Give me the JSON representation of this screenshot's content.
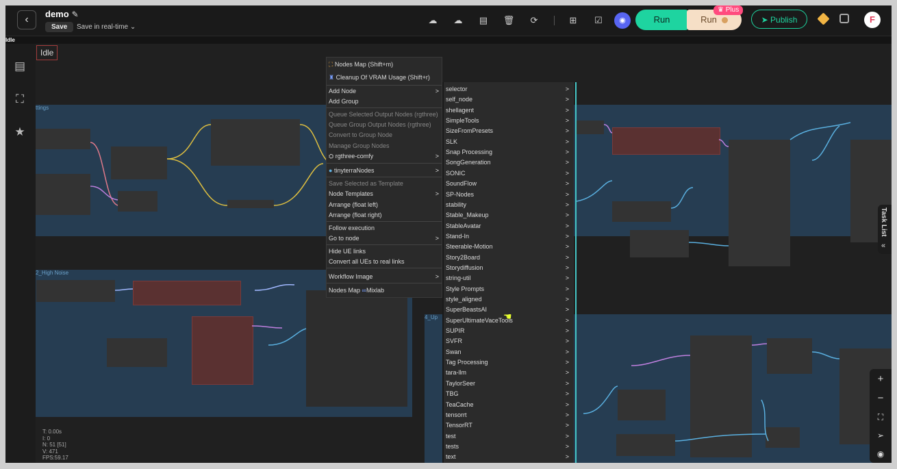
{
  "header": {
    "back_icon": "chevron-left-icon",
    "title": "demo",
    "edit_icon": "pencil-icon",
    "save_label": "Save",
    "save_mode": "Save in real-time",
    "toolbar_icons": [
      "cloud-upload-icon",
      "cloud-download-icon",
      "clipboard-icon",
      "trash-icon",
      "refresh-icon",
      "grid-icon",
      "checklist-icon",
      "discord-icon"
    ],
    "run_label": "Run",
    "run_plus_label": "Run",
    "plus_badge": "Plus",
    "publish_label": "Publish",
    "avatar_letter": "F",
    "accent_color": "#1ed4a0"
  },
  "status_line": "Idle",
  "sidebar": {
    "icons": [
      "document-icon",
      "sitemap-icon",
      "star-icon"
    ]
  },
  "canvas": {
    "idle_label": "Idle",
    "group_titles": [
      "ttings",
      "2_High Noise",
      "4_Up"
    ],
    "stats": [
      "T: 0.00s",
      "I: 0",
      "N: 51 [51]",
      "V: 471",
      "FPS:59.17"
    ]
  },
  "context_menu": {
    "items": [
      {
        "label": "Nodes Map (Shift+m)",
        "disabled": false,
        "submenu": false
      },
      {
        "label": "Cleanup Of VRAM Usage (Shift+r)",
        "disabled": false,
        "submenu": false
      },
      {
        "label": "Add Node",
        "disabled": false,
        "submenu": true
      },
      {
        "label": "Add Group",
        "disabled": false,
        "submenu": false
      },
      {
        "label": "Queue Selected Output Nodes (rgthree)",
        "disabled": true,
        "submenu": false
      },
      {
        "label": "Queue Group Output Nodes (rgthree)",
        "disabled": true,
        "submenu": false
      },
      {
        "label": "Convert to Group Node",
        "disabled": true,
        "submenu": false
      },
      {
        "label": "Manage Group Nodes",
        "disabled": true,
        "submenu": false
      },
      {
        "label": "rgthree-comfy",
        "disabled": false,
        "submenu": true
      },
      {
        "label": "tinyterraNodes",
        "disabled": false,
        "submenu": true
      },
      {
        "label": "Save Selected as Template",
        "disabled": true,
        "submenu": false
      },
      {
        "label": "Node Templates",
        "disabled": false,
        "submenu": true
      },
      {
        "label": "Arrange (float left)",
        "disabled": false,
        "submenu": false
      },
      {
        "label": "Arrange (float right)",
        "disabled": false,
        "submenu": false
      },
      {
        "label": "Follow execution",
        "disabled": false,
        "submenu": false
      },
      {
        "label": "Go to node",
        "disabled": false,
        "submenu": true
      },
      {
        "label": "Hide UE links",
        "disabled": false,
        "submenu": false
      },
      {
        "label": "Convert all UEs to real links",
        "disabled": false,
        "submenu": false
      },
      {
        "label": "Workflow Image",
        "disabled": false,
        "submenu": true
      },
      {
        "label": "Nodes Map",
        "disabled": false,
        "submenu": false
      }
    ],
    "mixlab_label": "Mixlab"
  },
  "add_node_submenu": {
    "items": [
      "selector",
      "self_node",
      "shellagent",
      "SimpleTools",
      "SizeFromPresets",
      "SLK",
      "Snap Processing",
      "SongGeneration",
      "SONIC",
      "SoundFlow",
      "SP-Nodes",
      "stability",
      "Stable_Makeup",
      "StableAvatar",
      "Stand-In",
      "Steerable-Motion",
      "Story2Board",
      "Storydiffusion",
      "string-util",
      "Style Prompts",
      "style_aligned",
      "SuperBeastsAI",
      "SuperUltimateVaceTools",
      "SUPIR",
      "SVFR",
      "Swan",
      "Tag Processing",
      "tara-llm",
      "TaylorSeer",
      "TBG",
      "TeaCache",
      "tensorrt",
      "TensorRT",
      "test",
      "tests",
      "text"
    ],
    "arrow": ">"
  },
  "right_panel": {
    "task_list_label": "Task List",
    "zoom_controls": [
      "plus-icon",
      "minus-icon",
      "fit-screen-icon",
      "locate-icon",
      "eye-icon"
    ]
  }
}
